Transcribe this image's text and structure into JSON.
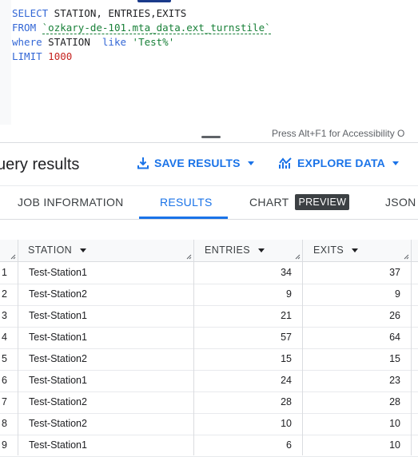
{
  "editor": {
    "lines": [
      [
        {
          "t": "SELECT",
          "c": "kw-upper"
        },
        {
          "t": " STATION, ENTRIES,EXITS",
          "c": "plain"
        }
      ],
      [
        {
          "t": "FROM",
          "c": "kw-upper"
        },
        {
          "t": " ",
          "c": "plain"
        },
        {
          "t": "`ozkary-de-101.mta_data.ext_turnstile`",
          "c": "tbl"
        }
      ],
      [
        {
          "t": "where",
          "c": "kw"
        },
        {
          "t": " STATION  ",
          "c": "plain"
        },
        {
          "t": "like",
          "c": "kw"
        },
        {
          "t": " ",
          "c": "plain"
        },
        {
          "t": "'Test%'",
          "c": "str"
        }
      ],
      [
        {
          "t": "LIMIT",
          "c": "kw-upper"
        },
        {
          "t": " ",
          "c": "plain"
        },
        {
          "t": "1000",
          "c": "num"
        }
      ]
    ],
    "a11y_hint": "Press Alt+F1 for Accessibility O"
  },
  "results": {
    "title": "uery results",
    "save_label": "SAVE RESULTS",
    "explore_label": "EXPLORE DATA"
  },
  "tabs": {
    "job_info": "JOB INFORMATION",
    "results": "RESULTS",
    "chart": "CHART",
    "preview_badge": "PREVIEW",
    "json": "JSON"
  },
  "table": {
    "columns": [
      "STATION",
      "ENTRIES",
      "EXITS"
    ],
    "rows": [
      {
        "n": "1",
        "station": "Test-Station1",
        "entries": "34",
        "exits": "37"
      },
      {
        "n": "2",
        "station": "Test-Station2",
        "entries": "9",
        "exits": "9"
      },
      {
        "n": "3",
        "station": "Test-Station1",
        "entries": "21",
        "exits": "26"
      },
      {
        "n": "4",
        "station": "Test-Station1",
        "entries": "57",
        "exits": "64"
      },
      {
        "n": "5",
        "station": "Test-Station2",
        "entries": "15",
        "exits": "15"
      },
      {
        "n": "6",
        "station": "Test-Station1",
        "entries": "24",
        "exits": "23"
      },
      {
        "n": "7",
        "station": "Test-Station2",
        "entries": "28",
        "exits": "28"
      },
      {
        "n": "8",
        "station": "Test-Station2",
        "entries": "10",
        "exits": "10"
      },
      {
        "n": "9",
        "station": "Test-Station1",
        "entries": "6",
        "exits": "10"
      }
    ]
  },
  "colors": {
    "accent": "#1a73e8",
    "keyword": "#3367d6",
    "string": "#188038",
    "number": "#c5221f"
  }
}
